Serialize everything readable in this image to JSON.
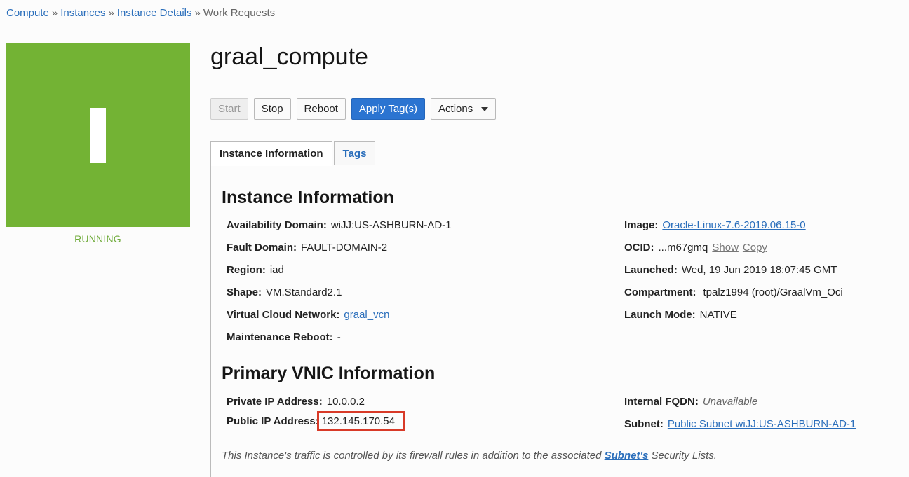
{
  "breadcrumb": {
    "items": [
      "Compute",
      "Instances",
      "Instance Details"
    ],
    "current": "Work Requests",
    "separator": "»"
  },
  "instance": {
    "letter": "I",
    "state": "RUNNING",
    "name": "graal_compute",
    "tile_color": "#73b334"
  },
  "buttons": {
    "start": "Start",
    "stop": "Stop",
    "reboot": "Reboot",
    "apply_tags": "Apply Tag(s)",
    "actions": "Actions"
  },
  "tabs": {
    "instance_information": "Instance Information",
    "tags": "Tags"
  },
  "instance_info": {
    "heading": "Instance Information",
    "availability_domain": {
      "label": "Availability Domain:",
      "value": "wiJJ:US-ASHBURN-AD-1"
    },
    "fault_domain": {
      "label": "Fault Domain:",
      "value": "FAULT-DOMAIN-2"
    },
    "region": {
      "label": "Region:",
      "value": "iad"
    },
    "shape": {
      "label": "Shape:",
      "value": "VM.Standard2.1"
    },
    "vcn": {
      "label": "Virtual Cloud Network:",
      "value": "graal_vcn"
    },
    "maintenance_reboot": {
      "label": "Maintenance Reboot:",
      "value": "-"
    },
    "image": {
      "label": "Image:",
      "value": "Oracle-Linux-7.6-2019.06.15-0"
    },
    "ocid": {
      "label": "OCID:",
      "value": "...m67gmq",
      "show": "Show",
      "copy": "Copy"
    },
    "launched": {
      "label": "Launched:",
      "value": "Wed, 19 Jun 2019 18:07:45 GMT"
    },
    "compartment": {
      "label": "Compartment:",
      "value": "tpalz1994 (root)/GraalVm_Oci"
    },
    "launch_mode": {
      "label": "Launch Mode:",
      "value": "NATIVE"
    }
  },
  "vnic_info": {
    "heading": "Primary VNIC Information",
    "private_ip": {
      "label": "Private IP Address:",
      "value": "10.0.0.2"
    },
    "public_ip": {
      "label": "Public IP Address:",
      "value": "132.145.170.54"
    },
    "internal_fqdn": {
      "label": "Internal FQDN:",
      "value": "Unavailable"
    },
    "subnet": {
      "label": "Subnet:",
      "value": "Public Subnet wiJJ:US-ASHBURN-AD-1"
    }
  },
  "note": {
    "prefix": "This Instance's traffic is controlled by its firewall rules in addition to the associated",
    "link": "Subnet's",
    "suffix": "Security Lists."
  }
}
